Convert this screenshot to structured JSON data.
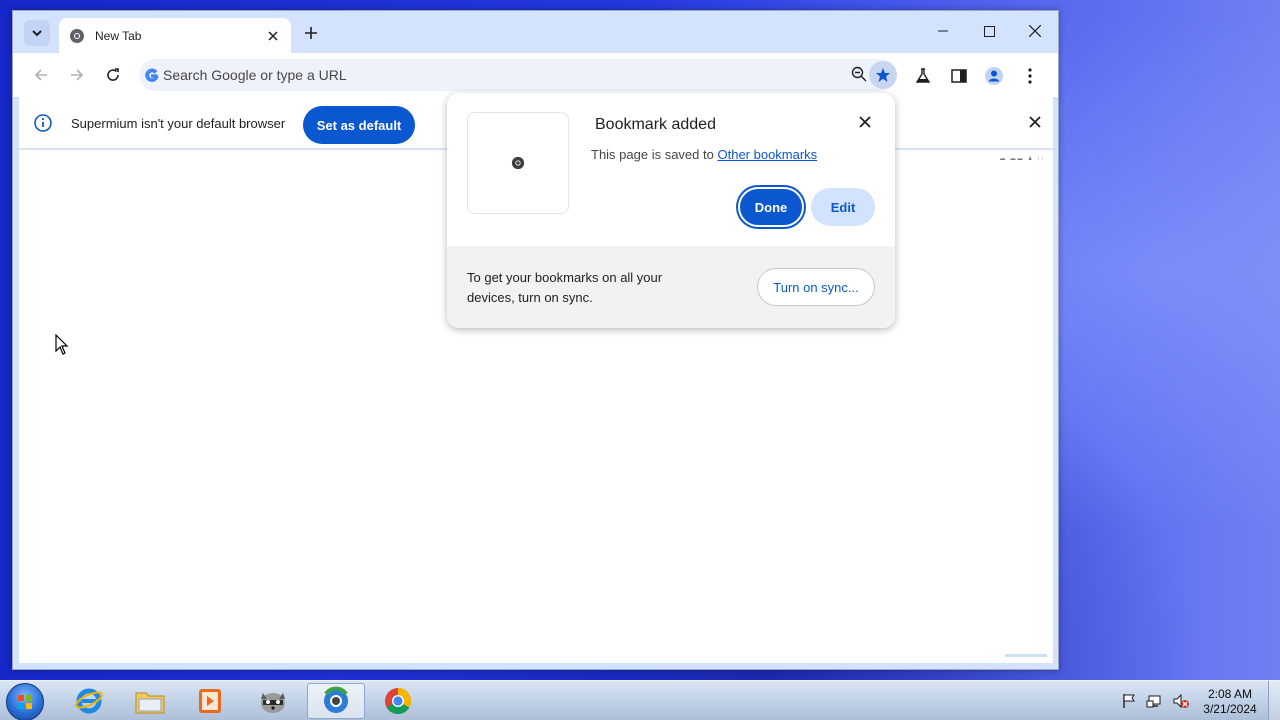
{
  "browser": {
    "tab": {
      "title": "New Tab"
    },
    "omnibox": {
      "placeholder": "Search Google or type a URL"
    },
    "infobar": {
      "message": "Supermium isn't your default browser",
      "set_default_label": "Set as default"
    }
  },
  "bookmark_bubble": {
    "title": "Bookmark added",
    "saved_prefix": "This page is saved to",
    "folder_link": "Other bookmarks",
    "done_label": "Done",
    "edit_label": "Edit",
    "sync_text": "To get your bookmarks on all your devices, turn on sync.",
    "sync_button_label": "Turn on sync..."
  },
  "taskbar": {
    "time": "2:08 AM",
    "date": "3/21/2024",
    "items": [
      "internet-explorer",
      "file-explorer",
      "media-player",
      "raccoon-app",
      "browser-active",
      "chrome"
    ]
  },
  "colors": {
    "accent": "#0b57d0",
    "tabstrip": "#d3e3fd",
    "desktop": "#2438e0"
  }
}
